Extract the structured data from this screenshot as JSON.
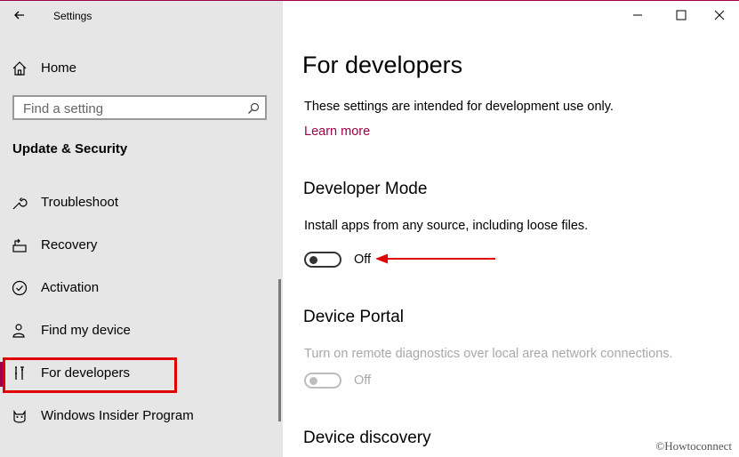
{
  "window": {
    "title": "Settings"
  },
  "sidebar": {
    "home_label": "Home",
    "search_placeholder": "Find a setting",
    "section_title": "Update & Security",
    "items": [
      {
        "label": "Troubleshoot",
        "icon": "wrench-icon"
      },
      {
        "label": "Recovery",
        "icon": "recovery-icon"
      },
      {
        "label": "Activation",
        "icon": "check-circle-icon"
      },
      {
        "label": "Find my device",
        "icon": "person-location-icon"
      },
      {
        "label": "For developers",
        "icon": "developer-tools-icon",
        "selected": true
      },
      {
        "label": "Windows Insider Program",
        "icon": "insider-cat-icon"
      }
    ]
  },
  "content": {
    "title": "For developers",
    "intro": "These settings are intended for development use only.",
    "learn_more": "Learn more",
    "developer_mode": {
      "heading": "Developer Mode",
      "description": "Install apps from any source, including loose files.",
      "toggle_state": "Off"
    },
    "device_portal": {
      "heading": "Device Portal",
      "description": "Turn on remote diagnostics over local area network connections.",
      "toggle_state": "Off"
    },
    "device_discovery": {
      "heading": "Device discovery"
    }
  },
  "watermark": "©Howtoconnect",
  "colors": {
    "accent": "#a0004a",
    "annotation": "#e10000",
    "sidebar_bg": "#e6e6e6"
  }
}
